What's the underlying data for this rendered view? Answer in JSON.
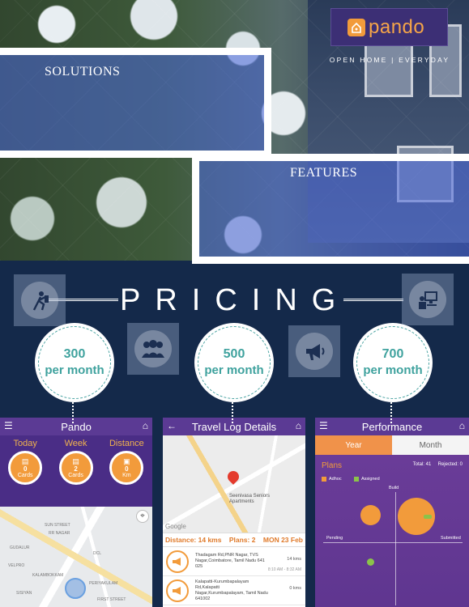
{
  "brand": {
    "name": "pando",
    "tagline": "OPEN HOME | EVERYDAY"
  },
  "sections": {
    "solutions": "SOLUTIONS",
    "features": "FEATURES"
  },
  "pricing": {
    "title": "PRICING",
    "plans": [
      {
        "price": "300",
        "unit": "per month"
      },
      {
        "price": "500",
        "unit": "per month"
      },
      {
        "price": "700",
        "unit": "per month"
      }
    ]
  },
  "screen_dashboard": {
    "title": "Pando",
    "stats": [
      {
        "label": "Today",
        "value": "0",
        "unit": "Cards"
      },
      {
        "label": "Week",
        "value": "2",
        "unit": "Cards"
      },
      {
        "label": "Distance",
        "value": "0",
        "unit": "Km"
      }
    ],
    "map_labels": [
      "SUN STREET",
      "RR NAGAR",
      "GUDALUR",
      "DCL",
      "VELPRO",
      "KALAMBOKKAM",
      "PERIYAKULAM",
      "SISIYAN",
      "FIRST STREET"
    ]
  },
  "screen_travel": {
    "title": "Travel Log Details",
    "map_address": "Seenivasa Seniors Apartments",
    "google": "Google",
    "distance": "Distance: 14 kms",
    "plans": "Plans: 2",
    "date": "MON 23 Feb",
    "entries": [
      {
        "address": "Thadagam Rd,PNR Nagar, TVS Nagar,Coimbatore, Tamil Nadu 641 025",
        "km": "14 kms",
        "time": "8:10 AM - 8:32 AM"
      },
      {
        "address": "Kalapatti-Kurumbapalayam Rd,Kalapatti Nagar,Kurumbapalayam, Tamil Nadu 641002",
        "km": "0 kms",
        "time": ""
      }
    ]
  },
  "screen_performance": {
    "title": "Performance",
    "tabs": [
      "Year",
      "Month"
    ],
    "heading": "Plans",
    "total": "Total: 41",
    "rejected": "Rejected: 0",
    "legend": [
      {
        "label": "Adhoc",
        "color": "#f29b3b"
      },
      {
        "label": "Assigned",
        "color": "#8bc34a"
      }
    ],
    "axes": {
      "top": "Build",
      "left": "Pending",
      "right": "Submitted"
    }
  },
  "colors": {
    "accent": "#f29b3b",
    "brand": "#3c2f75",
    "teal": "#3fa29e",
    "navy": "#14294a"
  }
}
